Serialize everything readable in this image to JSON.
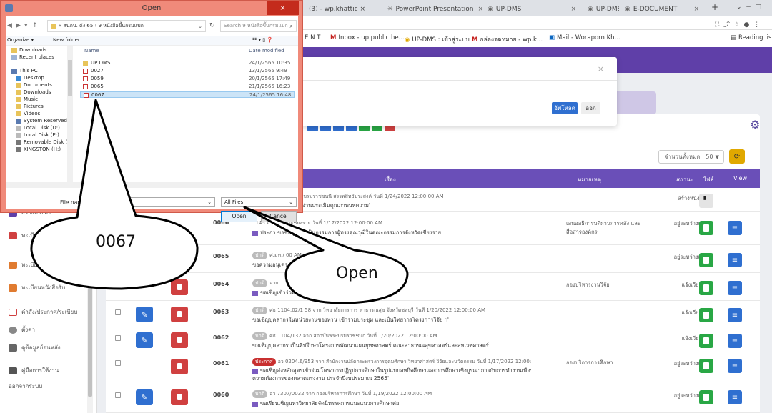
{
  "dialog": {
    "title": "Open",
    "close_symbol": "×",
    "address": {
      "path": "« สนกน. ค่ง 65  ›  9 หนังสือขึ้นกรมแบก",
      "dropdown": "⌄"
    },
    "search_placeholder": "Search 9 หนังสือขึ้นกรมแบก",
    "commands": {
      "organize": "Organize ▾",
      "new_folder": "New folder"
    },
    "nav_items": [
      "Downloads",
      "Recent places",
      "This PC",
      "Desktop",
      "Documents",
      "Downloads",
      "Music",
      "Pictures",
      "Videos",
      "System Reserved",
      "Local Disk (D:)",
      "Local Disk (E:)",
      "Removable Disk (",
      "KINGSTON (H:)"
    ],
    "columns": {
      "name": "Name",
      "date": "Date modified"
    },
    "files": [
      {
        "name": "UP DMS",
        "date": "24/1/2565 10:35",
        "kind": "folder"
      },
      {
        "name": "0027",
        "date": "13/1/2565 9:49",
        "kind": "pdf"
      },
      {
        "name": "0059",
        "date": "20/1/2565 17:49",
        "kind": "pdf"
      },
      {
        "name": "0065",
        "date": "21/1/2565 16:23",
        "kind": "pdf"
      },
      {
        "name": "0067",
        "date": "24/1/2565 16:48",
        "kind": "pdf",
        "selected": true
      }
    ],
    "filename_label": "File name:",
    "filename_value": "0067",
    "filetype": "All Files",
    "open_label": "Open",
    "cancel_label": "Cancel"
  },
  "callouts": {
    "filename": "0067",
    "open": "Open"
  },
  "browser": {
    "tabs": [
      {
        "label": "(3) - wp.khattic ×"
      },
      {
        "label": "PowerPoint Presentation"
      },
      {
        "label": "UP-DMS"
      },
      {
        "label": "UP-DMS"
      },
      {
        "label": "E-DOCUMENT"
      }
    ],
    "new_tab": "+",
    "bookmarks": [
      "E N T",
      "Inbox - up.public.he...",
      "UP-DMS : เข้าสู่ระบบ",
      "กล่องจดหมาย - wp.k...",
      "Mail - Woraporn Kh..."
    ],
    "reading_list": "Reading list"
  },
  "modal": {
    "close": "×",
    "upload": "อัพโหลด",
    "exit": "ออก"
  },
  "toolbar": {
    "count_select": "จำนวนทั้งหมด : 50",
    "colors": {
      "purple": "#5f3fa8",
      "blue": "#2f6fd0",
      "green": "#29a745",
      "red": "#d04040",
      "yellow": "#e0a800"
    }
  },
  "table": {
    "headers": {
      "subject": "เรื่อง",
      "note": "หมายเหตุ",
      "status": "สถานะ",
      "file": "ไฟล์",
      "view": "View"
    },
    "rows": [
      {
        "no": "",
        "line1": "7 จาก วิทยาลัยพยาบาลบรมราชชนนี สรรพสิทธิประสงค์ วันที่ 1/24/2022 12:00:00 AM",
        "line2": "าการเป็นผู้ทรงคุณวุฒิอ่านประเมินคุณภาพบทความ'",
        "note": "",
        "status": "สร้างหนังสือ",
        "file": "doc"
      },
      {
        "no": "0066",
        "line1": "1145 จาก จังหวัดเชียงราย วันที่ 1/17/2022 12:00:00 AM",
        "line2": "ประกา                    ขอข้อมูลเพื่อเป็นกรรมการผู้ทรงคุณวุฒิในคณะกรรมการจังหวัดเชียงราย",
        "note": "เสนออธิการบดีผ่านการคลัง และสื่อสารองค์กร",
        "status": "อยู่ระหว่างเสนอ",
        "file": "green"
      },
      {
        "no": "0065",
        "line1": "ศ.มท./                                                  00 AM",
        "line2": "ขอความอนุเคร                                            จำปีการศึกษา 2562'",
        "note": "",
        "status": "อยู่ระหว่างเสนอ",
        "file": "green"
      },
      {
        "no": "0064",
        "line1": "จาก",
        "line2": "ขอเชิญเข้าร่วม                                         2'",
        "note": "กองบริหารงานวิจัย",
        "status": "แจ้งเวียน",
        "file": "green"
      },
      {
        "no": "0063",
        "line1": "ศธ 1104.02/1 58 จาก วิทยาลัยการการ สาธารณสุข จังหวัดชลบุรี วันที่ 1/20/2022 12:00:00 AM",
        "line2": "ขอเชิญบุคลากรในหน่วยงานของท่าน เข้าร่วมประชุม และเป็นวิทยากรโครงการวิจัย ฯ'",
        "note": "",
        "status": "แจ้งเวียน",
        "file": "green"
      },
      {
        "no": "0062",
        "line1": "ศธ 1104/132 จาก สถาบันพระบรมราชชนก วันที่ 1/20/2022 12:00:00 AM",
        "line2": "ขอเชิญบุคลากร เป็นที่ปรึกษาโครงการพัฒนาแผนยุทธศาสตร์ คณะสาธารณสุขศาสตร์และสหเวชศาสตร์",
        "note": "",
        "status": "แจ้งเวียน",
        "file": "green"
      },
      {
        "no": "0061",
        "line1": "อว 0204.6/953 จาก สำนักงานปลัดกระทรวงการอุดมศึกษา วิทยาศาสตร์ วิจัยและนวัตกรรม วันที่ 1/17/2022 12:00:00 AM",
        "line2": "ขอเชิญส่งหลักสูตรเข้าร่วมโครงการปฏิรูปการศึกษาในรูปแบบสหกิจศึกษาและการศึกษาเชิงบูรณาการกับการทำงานเพื่อรองรับ",
        "line3": "ความต้องการของตลาดแรงงาน ประจำปีงบประมาณ 2565'",
        "badge": "ประกาศ",
        "note": "กองบริการการศึกษา",
        "status": "อยู่ระหว่างเสนอ",
        "file": "green"
      },
      {
        "no": "0060",
        "line1": "อว 7307/0032 จาก กองบริหารการศึกษา วันที่ 1/19/2022 12:00:00 AM",
        "line2": "ขอเรียนเชิญมหาวิทยาลัยจัดนิทรรศการแนะแนวการศึกษาต่อ'",
        "note": "",
        "status": "อยู่ระหว่างเสนอ",
        "file": "green"
      }
    ]
  },
  "sidebar": {
    "items": [
      "สร้างหนังสือ",
      "ทะเบียนรับ",
      "ทะเบียนหนังสือส่ง",
      "ทะเบียนหนังสือรับ",
      "คำสั่ง/ประกาศ/ระเบียบ",
      "ตั้งค่า",
      "ดูข้อมูลย้อนหลัง",
      "คู่มือการใช้งาน",
      "ออกจากระบบ"
    ]
  },
  "badge_label": "ปกติ"
}
